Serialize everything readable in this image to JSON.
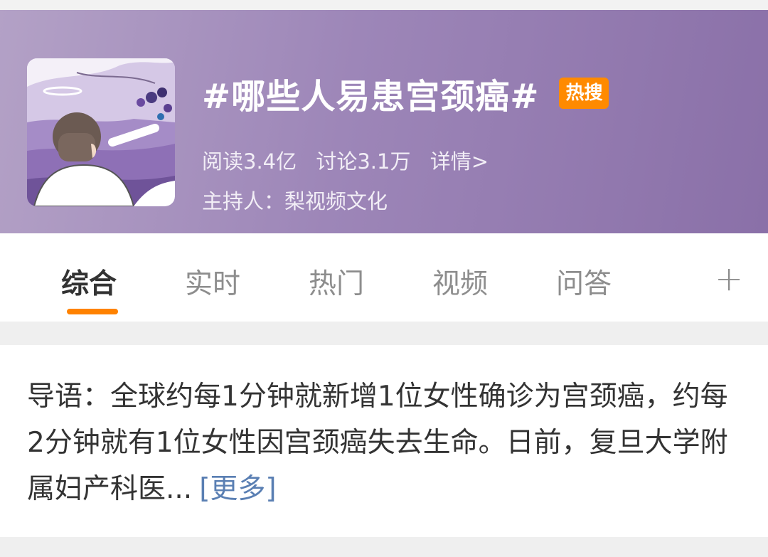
{
  "header": {
    "title": "#哪些人易患宫颈癌#",
    "badge": "热搜",
    "stats": {
      "reads": "阅读3.4亿",
      "discussions": "讨论3.1万",
      "details": "详情>"
    },
    "host": "主持人：梨视频文化"
  },
  "tabs": [
    {
      "label": "综合"
    },
    {
      "label": "实时"
    },
    {
      "label": "热门"
    },
    {
      "label": "视频"
    },
    {
      "label": "问答"
    }
  ],
  "tab_plus": "+",
  "intro": {
    "text": "导语：全球约每1分钟就新增1位女性确诊为宫颈癌，约每2分钟就有1位女性因宫颈癌失去生命。日前，复旦大学附属妇产科医...",
    "more": "[更多]"
  },
  "colors": {
    "header_bg": "#9d86b8",
    "badge": "#ff8a00",
    "tab_indicator": "#ff8200",
    "link": "#5a7fb3"
  }
}
